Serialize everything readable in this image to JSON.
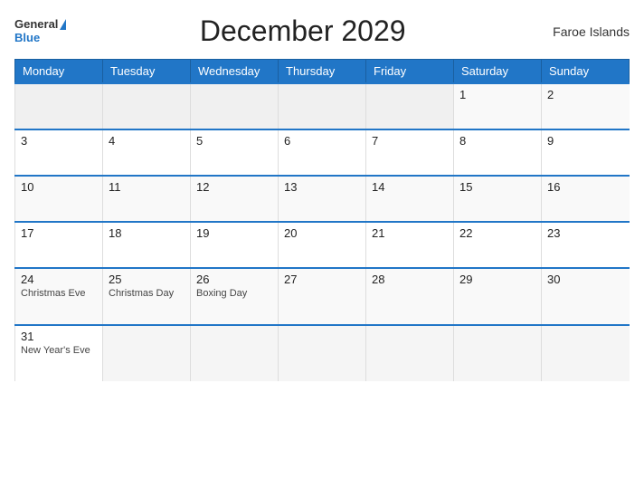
{
  "header": {
    "logo_general": "General",
    "logo_blue": "Blue",
    "title": "December 2029",
    "region": "Faroe Islands"
  },
  "days_of_week": [
    "Monday",
    "Tuesday",
    "Wednesday",
    "Thursday",
    "Friday",
    "Saturday",
    "Sunday"
  ],
  "weeks": [
    [
      {
        "day": "",
        "empty": true
      },
      {
        "day": "",
        "empty": true
      },
      {
        "day": "",
        "empty": true
      },
      {
        "day": "",
        "empty": true
      },
      {
        "day": "",
        "empty": true
      },
      {
        "day": "1",
        "empty": false,
        "event": ""
      },
      {
        "day": "2",
        "empty": false,
        "event": ""
      }
    ],
    [
      {
        "day": "3",
        "empty": false,
        "event": ""
      },
      {
        "day": "4",
        "empty": false,
        "event": ""
      },
      {
        "day": "5",
        "empty": false,
        "event": ""
      },
      {
        "day": "6",
        "empty": false,
        "event": ""
      },
      {
        "day": "7",
        "empty": false,
        "event": ""
      },
      {
        "day": "8",
        "empty": false,
        "event": ""
      },
      {
        "day": "9",
        "empty": false,
        "event": ""
      }
    ],
    [
      {
        "day": "10",
        "empty": false,
        "event": ""
      },
      {
        "day": "11",
        "empty": false,
        "event": ""
      },
      {
        "day": "12",
        "empty": false,
        "event": ""
      },
      {
        "day": "13",
        "empty": false,
        "event": ""
      },
      {
        "day": "14",
        "empty": false,
        "event": ""
      },
      {
        "day": "15",
        "empty": false,
        "event": ""
      },
      {
        "day": "16",
        "empty": false,
        "event": ""
      }
    ],
    [
      {
        "day": "17",
        "empty": false,
        "event": ""
      },
      {
        "day": "18",
        "empty": false,
        "event": ""
      },
      {
        "day": "19",
        "empty": false,
        "event": ""
      },
      {
        "day": "20",
        "empty": false,
        "event": ""
      },
      {
        "day": "21",
        "empty": false,
        "event": ""
      },
      {
        "day": "22",
        "empty": false,
        "event": ""
      },
      {
        "day": "23",
        "empty": false,
        "event": ""
      }
    ],
    [
      {
        "day": "24",
        "empty": false,
        "event": "Christmas Eve"
      },
      {
        "day": "25",
        "empty": false,
        "event": "Christmas Day"
      },
      {
        "day": "26",
        "empty": false,
        "event": "Boxing Day"
      },
      {
        "day": "27",
        "empty": false,
        "event": ""
      },
      {
        "day": "28",
        "empty": false,
        "event": ""
      },
      {
        "day": "29",
        "empty": false,
        "event": ""
      },
      {
        "day": "30",
        "empty": false,
        "event": ""
      }
    ],
    [
      {
        "day": "31",
        "empty": false,
        "event": "New Year's Eve"
      },
      {
        "day": "",
        "empty": true
      },
      {
        "day": "",
        "empty": true
      },
      {
        "day": "",
        "empty": true
      },
      {
        "day": "",
        "empty": true
      },
      {
        "day": "",
        "empty": true
      },
      {
        "day": "",
        "empty": true
      }
    ]
  ]
}
